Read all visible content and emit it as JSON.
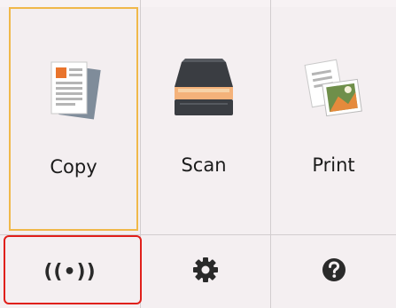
{
  "menu": {
    "copy_label": "Copy",
    "scan_label": "Scan",
    "print_label": "Print"
  },
  "bottom_bar": {
    "wireless_glyph": "((•))",
    "settings_icon": "gear-icon",
    "help_icon": "question-icon"
  },
  "colors": {
    "selected_border": "#f0b84a",
    "highlight_border": "#e0201b",
    "background": "#f4eff1"
  }
}
